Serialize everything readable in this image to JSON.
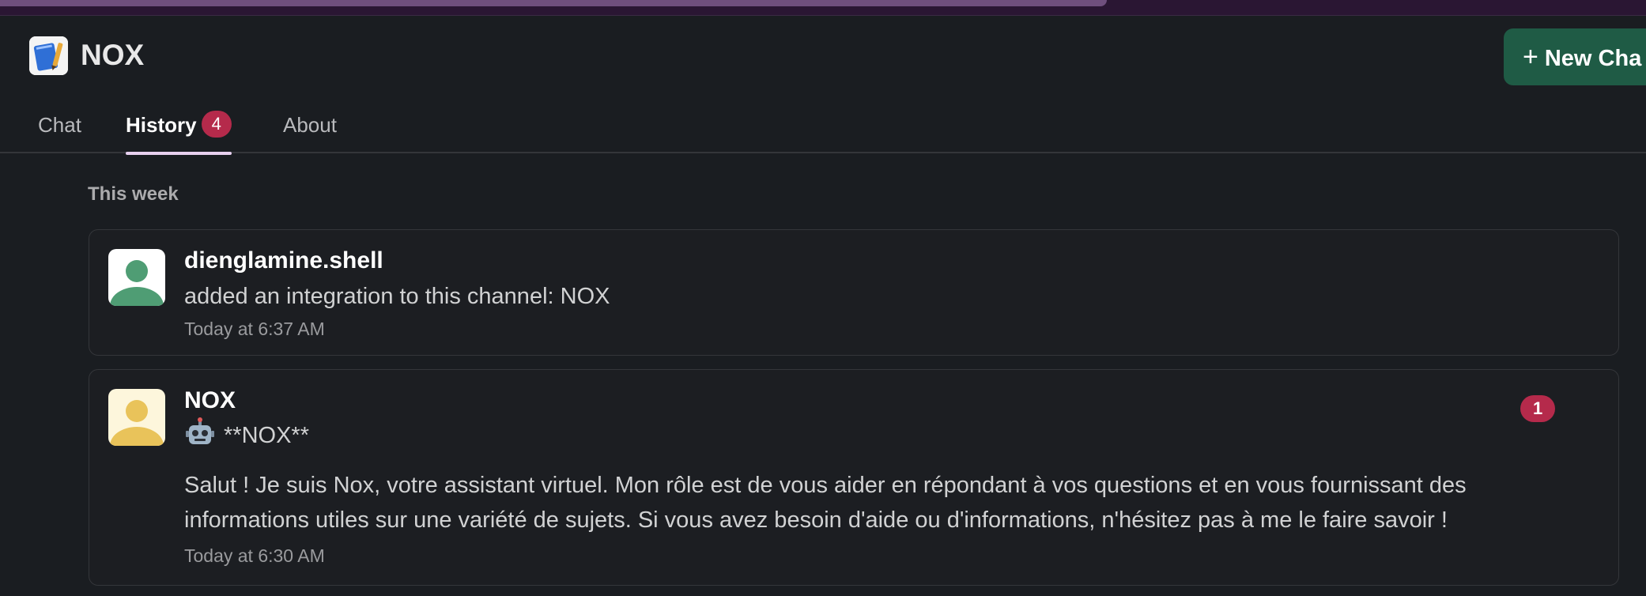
{
  "app": {
    "title": "NOX",
    "new_chat_label": "New Cha"
  },
  "tabs": [
    {
      "label": "Chat",
      "active": false
    },
    {
      "label": "History",
      "active": true,
      "badge": "4"
    },
    {
      "label": "About",
      "active": false
    }
  ],
  "history": {
    "section_label": "This week",
    "items": [
      {
        "author": "dienglamine.shell",
        "text": "added an integration to this channel: NOX",
        "time": "Today at 6:37 AM",
        "avatar_color": "#4f9d74"
      },
      {
        "author": "NOX",
        "headline": "**NOX**",
        "body": "Salut ! Je suis Nox, votre assistant virtuel. Mon rôle est de vous aider en répondant à vos questions et en vous fournissant des informations utiles sur une variété de sujets. Si vous avez besoin d'aide ou d'informations, n'hésitez pas à me le faire savoir !",
        "time": "Today at 6:30 AM",
        "unread_count": "1",
        "avatar_color": "#e9c35a"
      }
    ]
  },
  "colors": {
    "background": "#1a1d21",
    "accent_button": "#1f5b45",
    "badge": "#b52a4b",
    "active_tab_underline": "#e8d1f0"
  },
  "icons": {
    "app": "notebook-icon",
    "plus": "plus-icon",
    "robot": "robot-emoji-icon",
    "avatar": "user-avatar-icon"
  }
}
